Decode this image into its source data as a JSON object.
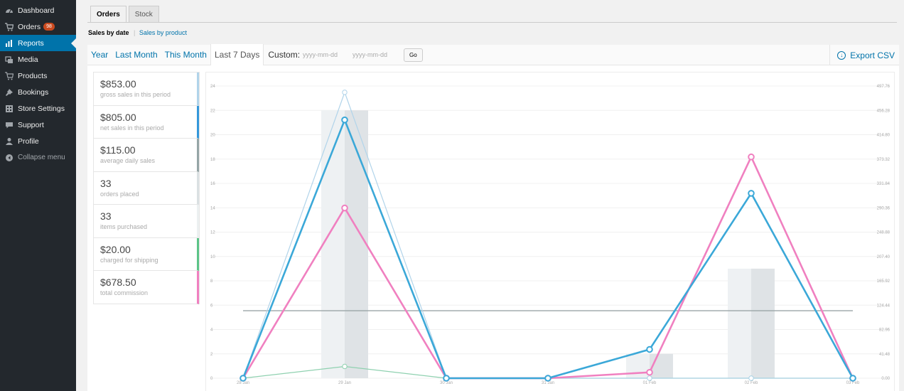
{
  "sidebar": {
    "items": [
      {
        "label": "Dashboard",
        "icon": "dashboard-icon"
      },
      {
        "label": "Orders",
        "icon": "cart-icon",
        "badge": "98"
      },
      {
        "label": "Reports",
        "icon": "chart-icon",
        "active": true
      },
      {
        "label": "Media",
        "icon": "media-icon"
      },
      {
        "label": "Products",
        "icon": "products-icon"
      },
      {
        "label": "Bookings",
        "icon": "pin-icon"
      },
      {
        "label": "Store Settings",
        "icon": "settings-icon"
      },
      {
        "label": "Support",
        "icon": "support-icon"
      },
      {
        "label": "Profile",
        "icon": "user-icon"
      }
    ],
    "collapse_label": "Collapse menu"
  },
  "tabs": [
    {
      "label": "Orders",
      "active": true
    },
    {
      "label": "Stock"
    }
  ],
  "subnav": {
    "current": "Sales by date",
    "separator": "|",
    "other": "Sales by product"
  },
  "ranges": [
    {
      "label": "Year"
    },
    {
      "label": "Last Month"
    },
    {
      "label": "This Month"
    },
    {
      "label": "Last 7 Days",
      "active": true
    }
  ],
  "custom": {
    "label": "Custom:",
    "from_placeholder": "yyyy-mm-dd",
    "to_placeholder": "yyyy-mm-dd",
    "go_label": "Go"
  },
  "export_label": "Export CSV",
  "legend": [
    {
      "value": "$853.00",
      "label": "gross sales in this period",
      "color": "#b1d4ea"
    },
    {
      "value": "$805.00",
      "label": "net sales in this period",
      "color": "#3498db"
    },
    {
      "value": "$115.00",
      "label": "average daily sales",
      "color": "#95a5a6"
    },
    {
      "value": "33",
      "label": "orders placed",
      "color": "#dbe1e3"
    },
    {
      "value": "33",
      "label": "items purchased",
      "color": "#ecf0f1"
    },
    {
      "value": "$20.00",
      "label": "charged for shipping",
      "color": "#5cc488"
    },
    {
      "value": "$678.50",
      "label": "total commission",
      "color": "#f080c0"
    }
  ],
  "chart_data": {
    "type": "line",
    "x": [
      "28 Jan",
      "29 Jan",
      "30 Jan",
      "31 Jan",
      "01 Feb",
      "02 Feb",
      "03 Feb"
    ],
    "y_left_ticks": [
      "0",
      "2",
      "4",
      "6",
      "8",
      "10",
      "12",
      "14",
      "16",
      "18",
      "20",
      "22",
      "24"
    ],
    "y_right_ticks": [
      "0.00",
      "41.48",
      "82.96",
      "124.44",
      "165.92",
      "207.40",
      "248.88",
      "290.36",
      "331.84",
      "373.32",
      "414.80",
      "456.28",
      "497.76"
    ],
    "ylim_left": [
      0,
      24
    ],
    "ylim_right": [
      0,
      497.76
    ],
    "series": [
      {
        "name": "gross sales in this period",
        "axis": "right",
        "kind": "line",
        "color": "#b1d4ea",
        "values": [
          0,
          487,
          0,
          0,
          0,
          0,
          0
        ]
      },
      {
        "name": "net sales in this period",
        "axis": "right",
        "kind": "line",
        "color": "#3ba8d8",
        "values": [
          0,
          440,
          0,
          0,
          49,
          315,
          0
        ]
      },
      {
        "name": "total commission",
        "axis": "right",
        "kind": "line",
        "color": "#f080c0",
        "values": [
          0,
          290,
          0,
          0,
          10,
          377,
          0
        ]
      },
      {
        "name": "charged for shipping",
        "axis": "right",
        "kind": "line",
        "color": "#8fd1b0",
        "values": [
          0,
          20,
          0,
          0,
          0,
          0,
          0
        ]
      },
      {
        "name": "average daily sales",
        "axis": "right",
        "kind": "flat",
        "color": "#9aa5a6",
        "values": [
          115,
          115,
          115,
          115,
          115,
          115,
          115
        ]
      },
      {
        "name": "orders placed",
        "axis": "left",
        "kind": "bar",
        "color": "#eef1f3",
        "values": [
          0,
          22,
          0,
          0,
          2,
          9,
          0
        ]
      },
      {
        "name": "items purchased",
        "axis": "left",
        "kind": "bar",
        "color": "#dfe3e6",
        "values": [
          0,
          22,
          0,
          0,
          2,
          9,
          0
        ]
      }
    ]
  }
}
